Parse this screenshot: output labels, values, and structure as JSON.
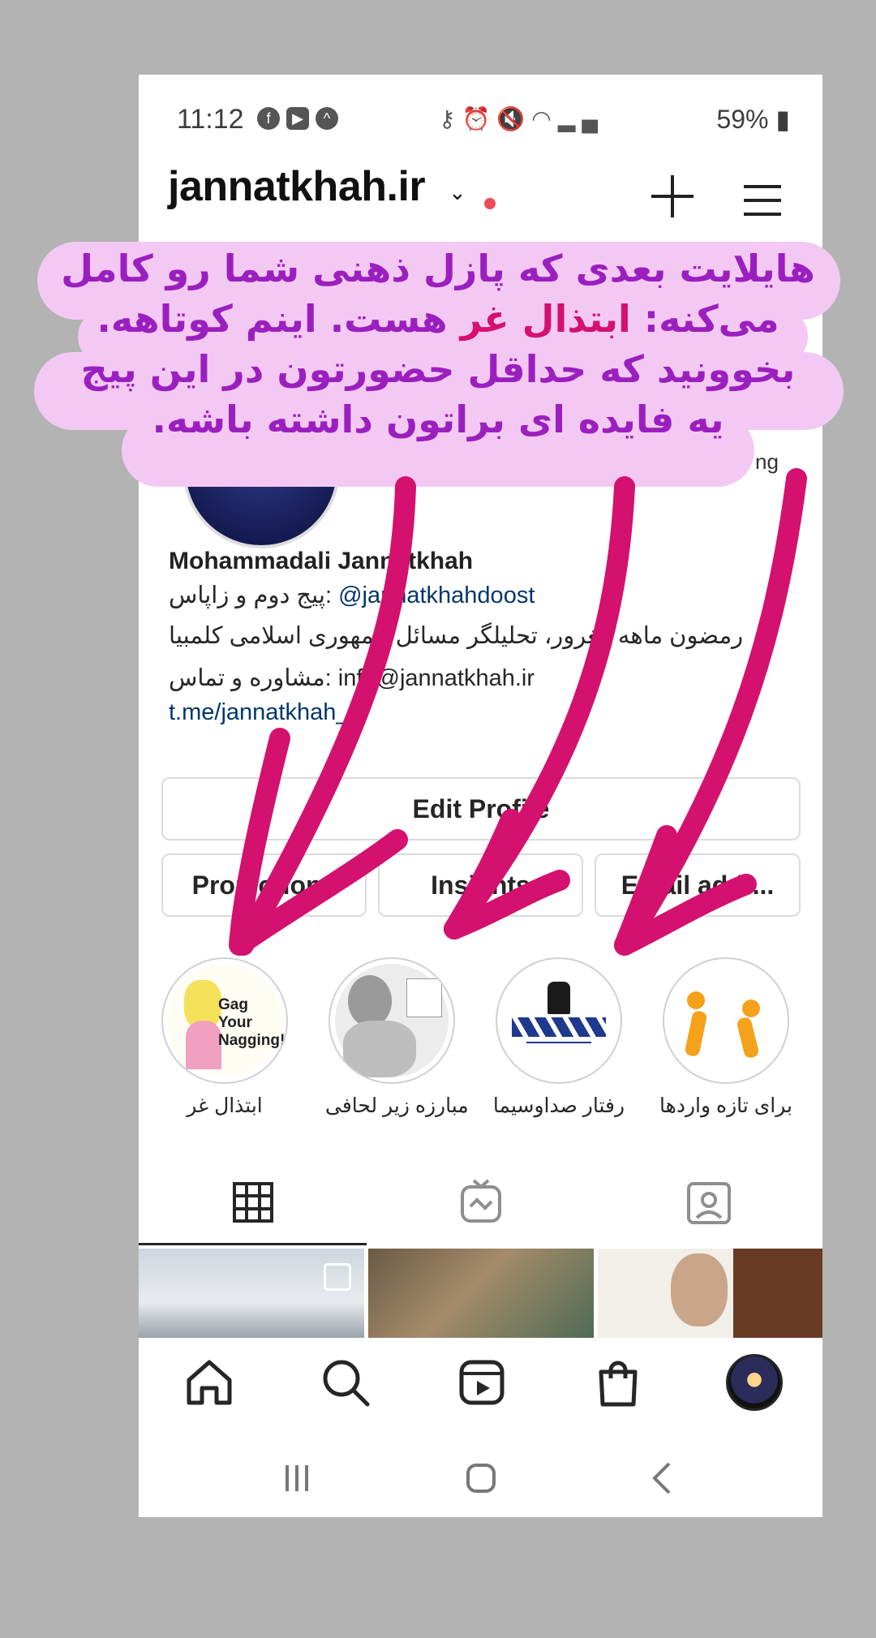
{
  "status_bar": {
    "time": "11:12",
    "battery": "59%",
    "left_icons": [
      "facebook-icon",
      "youtube-icon",
      "app-icon"
    ],
    "right_icons": [
      "key-icon",
      "alarm-icon",
      "mute-icon",
      "wifi-icon",
      "signal-icon",
      "signal-icon",
      "battery-icon"
    ]
  },
  "header": {
    "username": "jannatkhah.ir",
    "has_notification_dot": true
  },
  "profile": {
    "stat_fragment": "ng",
    "name": "Mohammadali Jannatkhah",
    "bio_line1_prefix": "پیج دوم و زاپاس: ",
    "bio_line1_mention": "@jannatkhahdoost",
    "bio_line2": "رمضون ماهه مغرور، تحلیلگر مسائل جمهوری اسلامی کلمبیا",
    "bio_line3": "مشاوره و تماس: info@jannatkhah.ir",
    "link": "t.me/jannatkhah_ir"
  },
  "buttons": {
    "edit_profile": "Edit Profile",
    "promotions": "Promotions",
    "insights": "Insights",
    "email_address": "Email addr..."
  },
  "highlights": [
    {
      "label": "ابتذال غر",
      "cover_text": "Gag Your Nagging!"
    },
    {
      "label": "مبارزه زیر لحافی"
    },
    {
      "label": "رفتار صداوسیما"
    },
    {
      "label": "برای تازه واردها"
    }
  ],
  "tabs": [
    "grid-icon",
    "igtv-icon",
    "tagged-icon"
  ],
  "bottom_nav": [
    "home-icon",
    "search-icon",
    "reels-icon",
    "shop-icon",
    "profile-avatar"
  ],
  "overlay": {
    "line1": "هایلایت بعدی که پازل ذهنی شما رو کامل",
    "line2_a": "می‌کنه: ",
    "line2_hot": "ابتذال غر",
    "line2_b": " هست. اینم کوتاهه.",
    "line3": "بخوونید که حداقل حضورتون در این پیج",
    "line4": "یه فایده ای براتون داشته باشه."
  },
  "colors": {
    "overlay_bg": "#f3c9f3",
    "overlay_text": "#9b1fbf",
    "highlight_text": "#d4116e",
    "arrow": "#d4116e"
  }
}
